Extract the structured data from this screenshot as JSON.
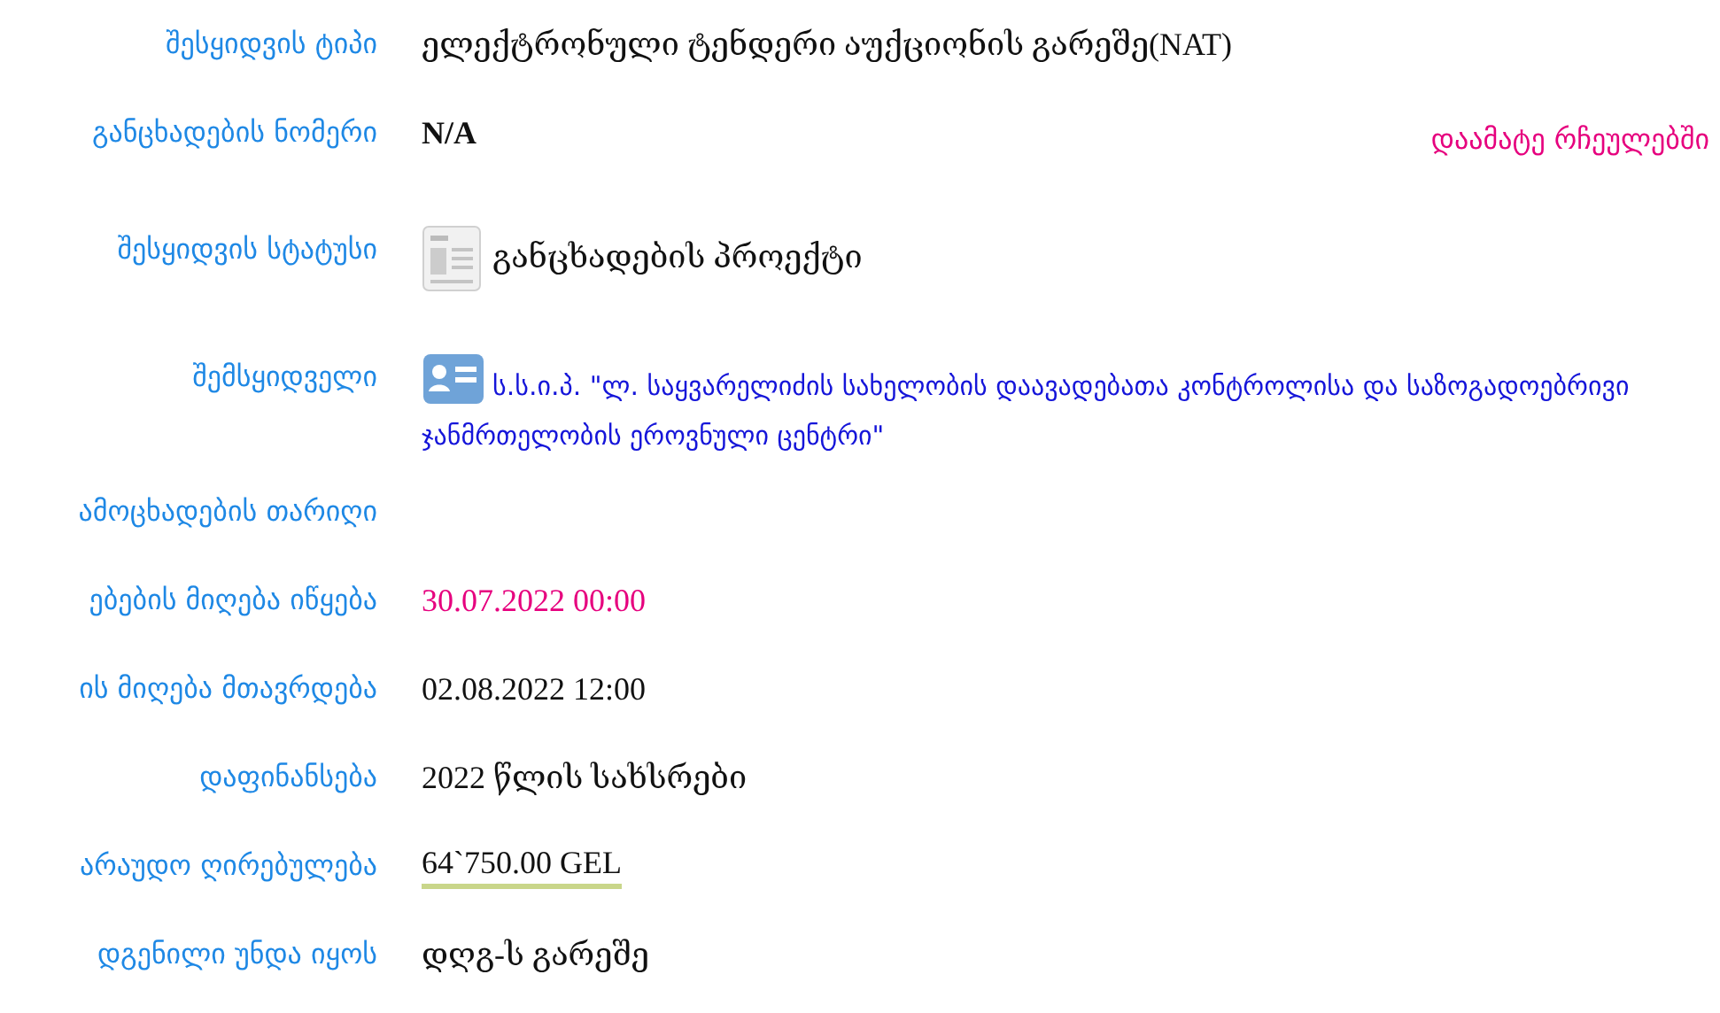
{
  "rows": [
    {
      "label": "შესყიდვის ტიპი",
      "kind": "text",
      "value": "ელექტრონული ტენდერი აუქციონის გარეშე(NAT)"
    },
    {
      "label": "განცხადების ნომერი",
      "kind": "bold",
      "value": "N/A",
      "action": "დაამატე რჩეულებში"
    },
    {
      "label": "შესყიდვის სტატუსი",
      "kind": "status",
      "value": "განცხადების პროექტი"
    },
    {
      "label": "შემსყიდველი",
      "kind": "org",
      "value": "ს.ს.ი.პ. \"ლ. საყვარელიძის სახელობის დაავადებათა კონტროლისა და საზოგადოებრივი ჯანმრთელობის ეროვნული ცენტრი\""
    },
    {
      "label": "ამოცხადების თარიღი",
      "kind": "text",
      "value": ""
    },
    {
      "label": "ებების მიღება იწყება",
      "kind": "highlight",
      "value": "30.07.2022 00:00"
    },
    {
      "label": "ის მიღება მთავრდება",
      "kind": "text",
      "value": "02.08.2022 12:00"
    },
    {
      "label": "დაფინანსება",
      "kind": "text",
      "value": "2022 წლის სახსრები"
    },
    {
      "label": "არაუდო ღირებულება",
      "kind": "money",
      "value": "64`750.00 GEL"
    },
    {
      "label": "დგენილი უნდა იყოს",
      "kind": "text",
      "value": "დღგ-ს გარეშე"
    }
  ]
}
